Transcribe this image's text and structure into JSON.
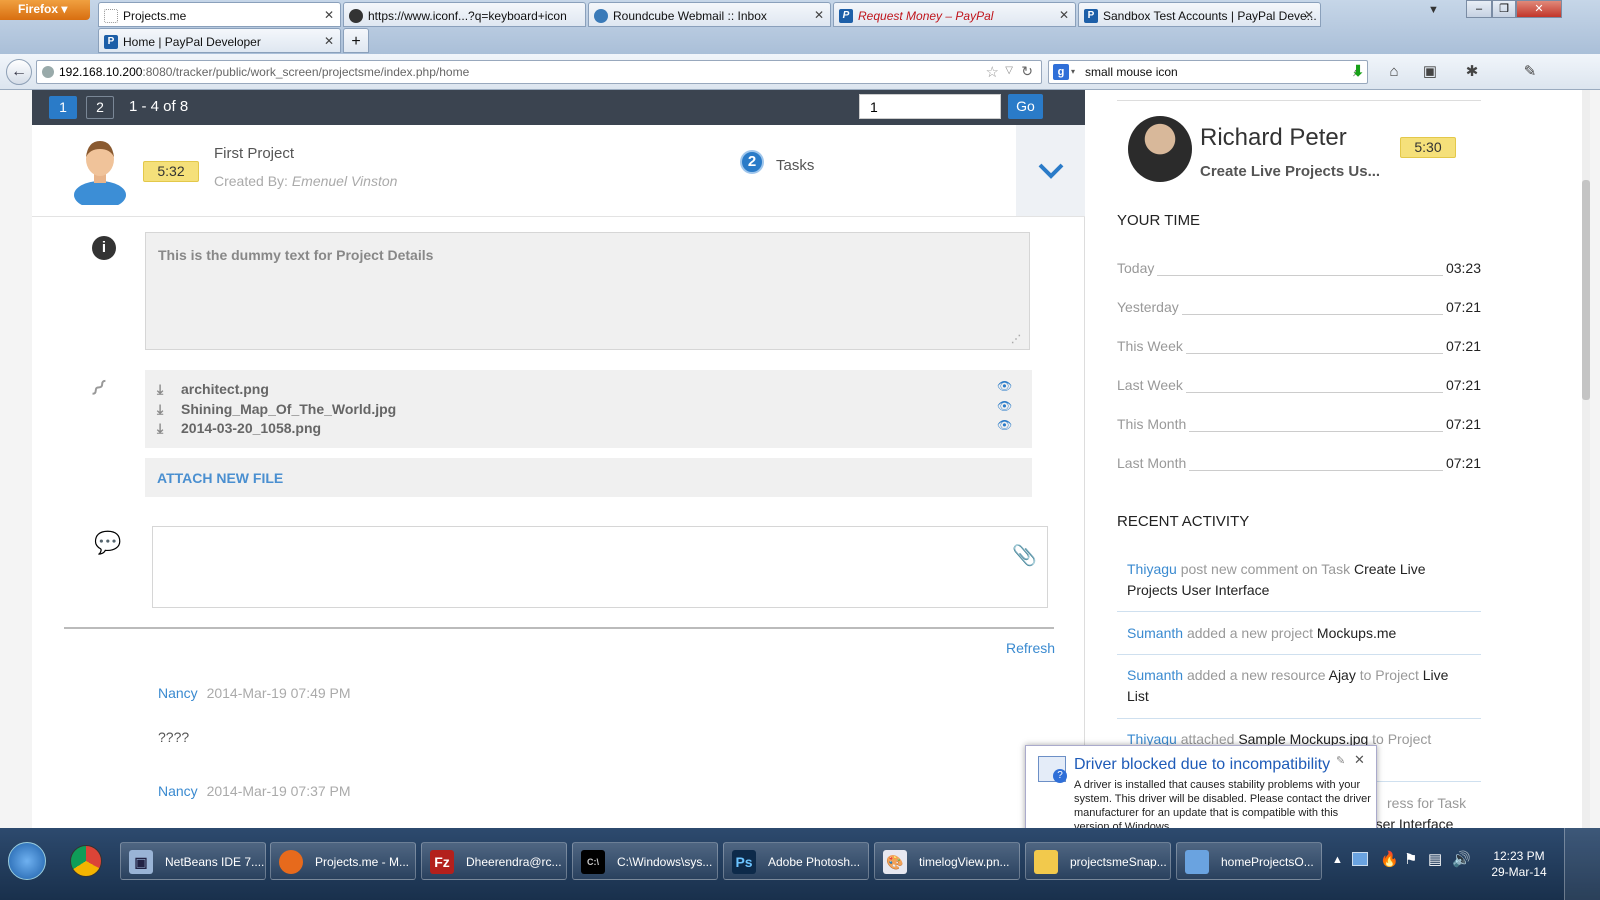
{
  "browser": {
    "menu_label": "Firefox",
    "tabs": [
      {
        "label": "Projects.me",
        "active": true
      },
      {
        "label": "https://www.iconf...?q=keyboard+icon"
      },
      {
        "label": "Roundcube Webmail :: Inbox"
      },
      {
        "label": "Request Money – PayPal"
      },
      {
        "label": "Sandbox Test Accounts | PayPal Deve..."
      },
      {
        "label": "Home | PayPal Developer"
      }
    ],
    "new_tab": "+",
    "url_host": "192.168.10.200",
    "url_rest": ":8080/tracker/public/work_screen/projectsme/index.php/home",
    "search_value": "small mouse icon"
  },
  "pager": {
    "pages": [
      "1",
      "2"
    ],
    "range": "1 - 4 of 8",
    "input_value": "1",
    "go": "Go"
  },
  "project": {
    "timer": "5:32",
    "title": "First Project",
    "created_by_label": "Created By:",
    "created_by": "Emenuel Vinston",
    "task_count": "2",
    "tasks_label": "Tasks",
    "details": "This is the dummy text for Project Details",
    "files": [
      "architect.png",
      "Shining_Map_Of_The_World.jpg",
      "2014-03-20_1058.png"
    ],
    "attach_label": "ATTACH NEW FILE",
    "refresh": "Refresh",
    "comments": [
      {
        "author": "Nancy",
        "date": "2014-Mar-19 07:49 PM",
        "text": "????"
      },
      {
        "author": "Nancy",
        "date": "2014-Mar-19 07:37 PM",
        "text": ""
      }
    ]
  },
  "profile": {
    "name": "Richard Peter",
    "subtitle": "Create Live Projects Us...",
    "timer": "5:30"
  },
  "your_time": {
    "heading": "YOUR TIME",
    "rows": [
      {
        "label": "Today",
        "value": "03:23"
      },
      {
        "label": "Yesterday",
        "value": "07:21"
      },
      {
        "label": "This Week",
        "value": "07:21"
      },
      {
        "label": "Last Week",
        "value": "07:21"
      },
      {
        "label": "This Month",
        "value": "07:21"
      },
      {
        "label": "Last Month",
        "value": "07:21"
      }
    ]
  },
  "recent": {
    "heading": "RECENT ACTIVITY",
    "items": [
      {
        "user": "Thiyagu",
        "action": "post new comment on Task",
        "target": "Create Live Projects User Interface"
      },
      {
        "user": "Sumanth",
        "action": "added a new project",
        "target": "Mockups.me"
      },
      {
        "user": "Sumanth",
        "action": "added a new resource",
        "target": "Ajay",
        "mid": "to Project",
        "target2": "Live List"
      },
      {
        "user": "Thiyagu",
        "action": "attached",
        "target": "Sample Mockups.jpg",
        "mid": "to Project"
      },
      {
        "user": "",
        "action": "ress for Task",
        "target": "ojects User Interface"
      }
    ]
  },
  "notification": {
    "title": "Driver blocked due to incompatibility",
    "body": "A driver is installed that causes stability problems with your system. This driver will be disabled. Please contact the driver manufacturer for an update that is compatible with this version of Windows."
  },
  "taskbar": {
    "items": [
      "NetBeans IDE 7....",
      "Projects.me - M...",
      "Dheerendra@rc...",
      "C:\\Windows\\sys...",
      "Adobe Photosh...",
      "timelogView.pn...",
      "projectsmeSnap...",
      "homeProjectsO..."
    ],
    "time": "12:23 PM",
    "date": "29-Mar-14"
  }
}
